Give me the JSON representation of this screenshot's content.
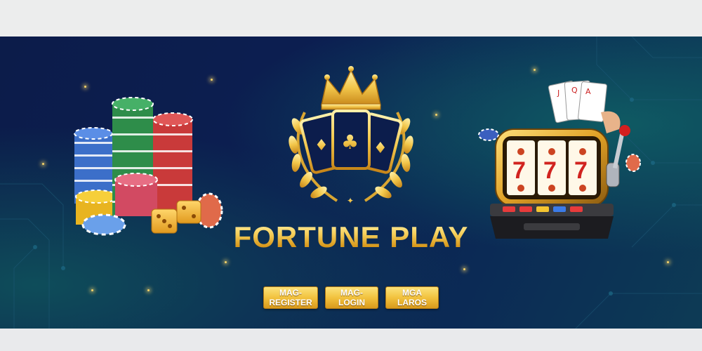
{
  "banner": {
    "title": "FORTUNE PLAY",
    "colors": {
      "gold": "#f3c14a",
      "navy": "#0c1c4a",
      "teal": "#0f5a63"
    }
  },
  "buttons": [
    {
      "label": "MAG-REGISTER"
    },
    {
      "label": "MAG-LOGIN"
    },
    {
      "label": "MGA LAROS"
    }
  ],
  "emblem": {
    "icon": "crown-cards-laurel-icon",
    "card_suits": [
      "♣",
      "♦",
      "♠"
    ]
  },
  "slot_machine": {
    "reels": [
      "7",
      "7",
      "7"
    ]
  },
  "playing_cards": [
    "J",
    "Q",
    "A"
  ]
}
